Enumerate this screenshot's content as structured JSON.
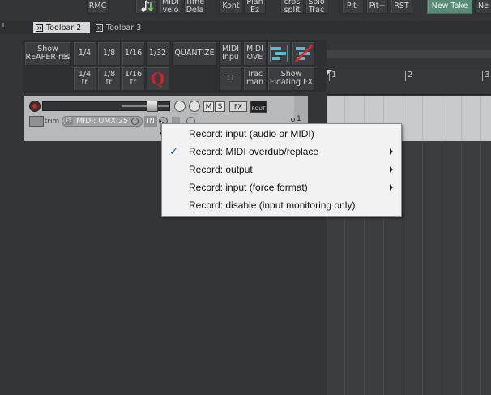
{
  "top_toolbar": {
    "rmc": "RMC",
    "midi_velo": "MIDI\nvelo",
    "time_dela": "Time\nDela",
    "kont": "Kont",
    "plan_ez": "Plan\nEz",
    "cros_split": "cros\nsplit",
    "solo_trac": "Solo\nTrac",
    "pit_minus": "Pit-",
    "pit_plus": "Pit+",
    "rst": "RST",
    "new_take": "New Take",
    "ne_partial": "Ne"
  },
  "tabs": {
    "bang": "!",
    "toolbar2": "Toolbar 2",
    "toolbar3": "Toolbar 3"
  },
  "toolbar2": {
    "show_reaper_res": "Show\nREAPER res",
    "q_1_4": "1/4",
    "q_1_8": "1/8",
    "q_1_16": "1/16",
    "q_1_32": "1/32",
    "quantize": "QUANTIZE",
    "midi_inpu": "MIDI\nInpu",
    "midi_ove": "MIDI\nOVE",
    "q_1_4_tr": "1/4\ntr",
    "q_1_8_tr": "1/8\ntr",
    "q_1_16_tr": "1/16\ntr",
    "q_logo": "Q",
    "tt": "TT",
    "trac_man": "Trac\nman",
    "show_floating_fx": "Show\nFloating FX"
  },
  "ruler": {
    "m1": "1",
    "m2": "2",
    "m3": "3"
  },
  "track": {
    "m_label": "M",
    "s_label": "S",
    "fx_label": "FX",
    "rout_label": "ROUT",
    "trim_label": "trim",
    "fx_small": "FX",
    "midi_input": "MIDI: UMX 25",
    "in_label": "IN",
    "track_number": "1"
  },
  "record_menu": {
    "items": [
      {
        "label": "Record: input (audio or MIDI)",
        "checked": false,
        "submenu": false
      },
      {
        "label": "Record: MIDI overdub/replace",
        "checked": true,
        "submenu": true
      },
      {
        "label": "Record: output",
        "checked": false,
        "submenu": true
      },
      {
        "label": "Record: input (force format)",
        "checked": false,
        "submenu": true
      },
      {
        "label": "Record: disable (input monitoring only)",
        "checked": false,
        "submenu": false
      }
    ],
    "check_glyph": "✓"
  },
  "colors": {
    "accent_green": "#5a8a78",
    "menu_bg": "#f2f2f2",
    "check_blue": "#1a4e9a",
    "quantize_logo_red": "#c0262d"
  }
}
